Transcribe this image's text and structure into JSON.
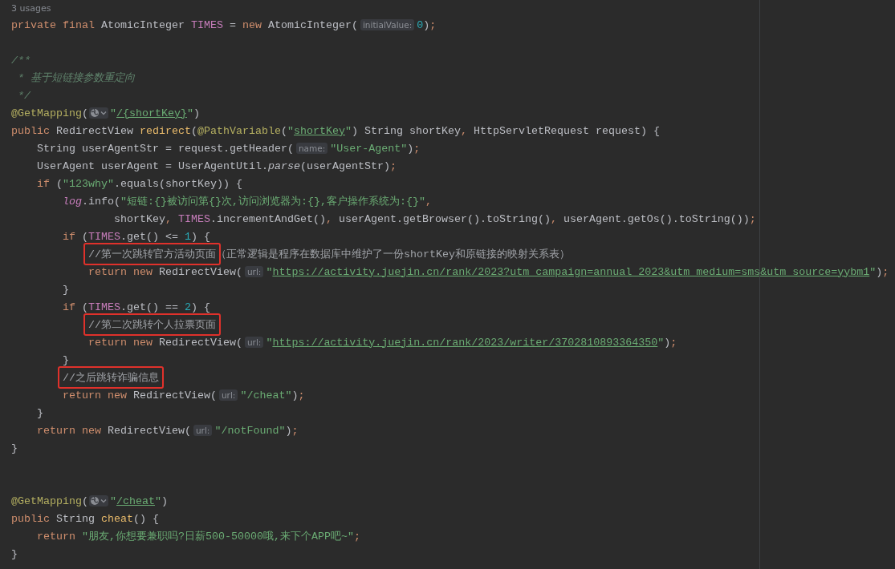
{
  "usages_hint": "3 usages",
  "lines": [
    {
      "kind": "code",
      "tokens": [
        {
          "kind": "keyword",
          "text": "private final "
        },
        {
          "kind": "plain",
          "text": "AtomicInteger "
        },
        {
          "kind": "field",
          "text": "TIMES"
        },
        {
          "kind": "plain",
          "text": " = "
        },
        {
          "kind": "keyword",
          "text": "new "
        },
        {
          "kind": "plain",
          "text": "AtomicInteger("
        },
        {
          "kind": "hint",
          "text": "initialValue:"
        },
        {
          "kind": "number",
          "text": "0"
        },
        {
          "kind": "plain",
          "text": ")"
        },
        {
          "kind": "keyword",
          "text": ";"
        }
      ]
    },
    {
      "kind": "blank"
    },
    {
      "kind": "code",
      "tokens": [
        {
          "kind": "doc",
          "text": "/**"
        }
      ]
    },
    {
      "kind": "code",
      "tokens": [
        {
          "kind": "doc",
          "text": " * 基于短链接参数重定向"
        }
      ]
    },
    {
      "kind": "code",
      "tokens": [
        {
          "kind": "doc",
          "text": " */"
        }
      ]
    },
    {
      "kind": "code",
      "tokens": [
        {
          "kind": "annotation",
          "text": "@GetMapping"
        },
        {
          "kind": "plain",
          "text": "("
        },
        {
          "kind": "web-icon"
        },
        {
          "kind": "string",
          "text": "\""
        },
        {
          "kind": "url",
          "text": "/{shortKey}"
        },
        {
          "kind": "string",
          "text": "\""
        },
        {
          "kind": "plain",
          "text": ")"
        }
      ]
    },
    {
      "kind": "code",
      "tokens": [
        {
          "kind": "keyword",
          "text": "public "
        },
        {
          "kind": "plain",
          "text": "RedirectView "
        },
        {
          "kind": "method",
          "text": "redirect"
        },
        {
          "kind": "plain",
          "text": "("
        },
        {
          "kind": "annotation",
          "text": "@PathVariable"
        },
        {
          "kind": "plain",
          "text": "("
        },
        {
          "kind": "string",
          "text": "\""
        },
        {
          "kind": "url",
          "text": "shortKey"
        },
        {
          "kind": "string",
          "text": "\""
        },
        {
          "kind": "plain",
          "text": ") String shortKey"
        },
        {
          "kind": "keyword",
          "text": ", "
        },
        {
          "kind": "plain",
          "text": "HttpServletRequest request) {"
        }
      ]
    },
    {
      "kind": "code",
      "tokens": [
        {
          "kind": "plain",
          "text": "    String userAgentStr = request.getHeader("
        },
        {
          "kind": "hint",
          "text": "name:"
        },
        {
          "kind": "string",
          "text": "\"User-Agent\""
        },
        {
          "kind": "plain",
          "text": ")"
        },
        {
          "kind": "keyword",
          "text": ";"
        }
      ]
    },
    {
      "kind": "code",
      "tokens": [
        {
          "kind": "plain",
          "text": "    UserAgent userAgent = UserAgentUtil."
        },
        {
          "kind": "italic",
          "text": "parse"
        },
        {
          "kind": "plain",
          "text": "(userAgentStr)"
        },
        {
          "kind": "keyword",
          "text": ";"
        }
      ]
    },
    {
      "kind": "code",
      "tokens": [
        {
          "kind": "keyword",
          "text": "    if "
        },
        {
          "kind": "plain",
          "text": "("
        },
        {
          "kind": "string",
          "text": "\"123why\""
        },
        {
          "kind": "plain",
          "text": ".equals(shortKey)) {"
        }
      ]
    },
    {
      "kind": "code",
      "tokens": [
        {
          "kind": "static-field",
          "text": "        log"
        },
        {
          "kind": "plain",
          "text": ".info("
        },
        {
          "kind": "string",
          "text": "\"短链:{}被访问第{}次,访问浏览器为:{},客户操作系统为:{}\""
        },
        {
          "kind": "keyword",
          "text": ","
        }
      ]
    },
    {
      "kind": "code",
      "tokens": [
        {
          "kind": "plain",
          "text": "                shortKey"
        },
        {
          "kind": "keyword",
          "text": ", "
        },
        {
          "kind": "field",
          "text": "TIMES"
        },
        {
          "kind": "plain",
          "text": ".incrementAndGet()"
        },
        {
          "kind": "keyword",
          "text": ", "
        },
        {
          "kind": "plain",
          "text": "userAgent.getBrowser().toString()"
        },
        {
          "kind": "keyword",
          "text": ", "
        },
        {
          "kind": "plain",
          "text": "userAgent.getOs().toString())"
        },
        {
          "kind": "keyword",
          "text": ";"
        }
      ]
    },
    {
      "kind": "code",
      "tokens": [
        {
          "kind": "keyword",
          "text": "        if "
        },
        {
          "kind": "plain",
          "text": "("
        },
        {
          "kind": "field",
          "text": "TIMES"
        },
        {
          "kind": "plain",
          "text": ".get() <= "
        },
        {
          "kind": "number",
          "text": "1"
        },
        {
          "kind": "plain",
          "text": ") {"
        }
      ]
    },
    {
      "kind": "code",
      "tokens": [
        {
          "kind": "marked",
          "text": "            //第一次跳转官方活动页面"
        },
        {
          "kind": "comment",
          "text": "（正常逻辑是程序在数据库中维护了一份shortKey和原链接的映射关系表）"
        }
      ]
    },
    {
      "kind": "code",
      "tokens": [
        {
          "kind": "keyword",
          "text": "            return new "
        },
        {
          "kind": "plain",
          "text": "RedirectView("
        },
        {
          "kind": "hint",
          "text": "url:"
        },
        {
          "kind": "string",
          "text": "\""
        },
        {
          "kind": "url",
          "text": "https://activity.juejin.cn/rank/2023?utm_campaign=annual_2023&utm_medium=sms&utm_source=yybm1"
        },
        {
          "kind": "string",
          "text": "\""
        },
        {
          "kind": "plain",
          "text": ")"
        },
        {
          "kind": "keyword",
          "text": ";"
        }
      ]
    },
    {
      "kind": "code",
      "tokens": [
        {
          "kind": "plain",
          "text": "        }"
        }
      ]
    },
    {
      "kind": "code",
      "tokens": [
        {
          "kind": "keyword",
          "text": "        if "
        },
        {
          "kind": "plain",
          "text": "("
        },
        {
          "kind": "field",
          "text": "TIMES"
        },
        {
          "kind": "plain",
          "text": ".get() == "
        },
        {
          "kind": "number",
          "text": "2"
        },
        {
          "kind": "plain",
          "text": ") {"
        }
      ]
    },
    {
      "kind": "code",
      "tokens": [
        {
          "kind": "marked",
          "text": "            //第二次跳转个人拉票页面"
        }
      ]
    },
    {
      "kind": "code",
      "tokens": [
        {
          "kind": "keyword",
          "text": "            return new "
        },
        {
          "kind": "plain",
          "text": "RedirectView("
        },
        {
          "kind": "hint",
          "text": "url:"
        },
        {
          "kind": "string",
          "text": "\""
        },
        {
          "kind": "url",
          "text": "https://activity.juejin.cn/rank/2023/writer/3702810893364350"
        },
        {
          "kind": "string",
          "text": "\""
        },
        {
          "kind": "plain",
          "text": ")"
        },
        {
          "kind": "keyword",
          "text": ";"
        }
      ]
    },
    {
      "kind": "code",
      "tokens": [
        {
          "kind": "plain",
          "text": "        }"
        }
      ]
    },
    {
      "kind": "code",
      "tokens": [
        {
          "kind": "marked",
          "text": "        //之后跳转诈骗信息"
        }
      ]
    },
    {
      "kind": "code",
      "tokens": [
        {
          "kind": "keyword",
          "text": "        return new "
        },
        {
          "kind": "plain",
          "text": "RedirectView("
        },
        {
          "kind": "hint",
          "text": "url:"
        },
        {
          "kind": "string",
          "text": "\"/cheat\""
        },
        {
          "kind": "plain",
          "text": ")"
        },
        {
          "kind": "keyword",
          "text": ";"
        }
      ]
    },
    {
      "kind": "code",
      "tokens": [
        {
          "kind": "plain",
          "text": "    }"
        }
      ]
    },
    {
      "kind": "code",
      "tokens": [
        {
          "kind": "keyword",
          "text": "    return new "
        },
        {
          "kind": "plain",
          "text": "RedirectView("
        },
        {
          "kind": "hint",
          "text": "url:"
        },
        {
          "kind": "string",
          "text": "\"/notFound\""
        },
        {
          "kind": "plain",
          "text": ")"
        },
        {
          "kind": "keyword",
          "text": ";"
        }
      ]
    },
    {
      "kind": "code",
      "tokens": [
        {
          "kind": "plain",
          "text": "}"
        }
      ]
    },
    {
      "kind": "blank"
    },
    {
      "kind": "blank"
    },
    {
      "kind": "code",
      "tokens": [
        {
          "kind": "annotation",
          "text": "@GetMapping"
        },
        {
          "kind": "plain",
          "text": "("
        },
        {
          "kind": "web-icon"
        },
        {
          "kind": "string",
          "text": "\""
        },
        {
          "kind": "url",
          "text": "/cheat"
        },
        {
          "kind": "string",
          "text": "\""
        },
        {
          "kind": "plain",
          "text": ")"
        }
      ]
    },
    {
      "kind": "code",
      "tokens": [
        {
          "kind": "keyword",
          "text": "public "
        },
        {
          "kind": "plain",
          "text": "String "
        },
        {
          "kind": "method",
          "text": "cheat"
        },
        {
          "kind": "plain",
          "text": "() {"
        }
      ]
    },
    {
      "kind": "code",
      "tokens": [
        {
          "kind": "keyword",
          "text": "    return "
        },
        {
          "kind": "string",
          "text": "\"朋友,你想要兼职吗?日薪500-50000哦,来下个APP吧~\""
        },
        {
          "kind": "keyword",
          "text": ";"
        }
      ]
    },
    {
      "kind": "code",
      "tokens": [
        {
          "kind": "plain",
          "text": "}"
        }
      ]
    }
  ]
}
